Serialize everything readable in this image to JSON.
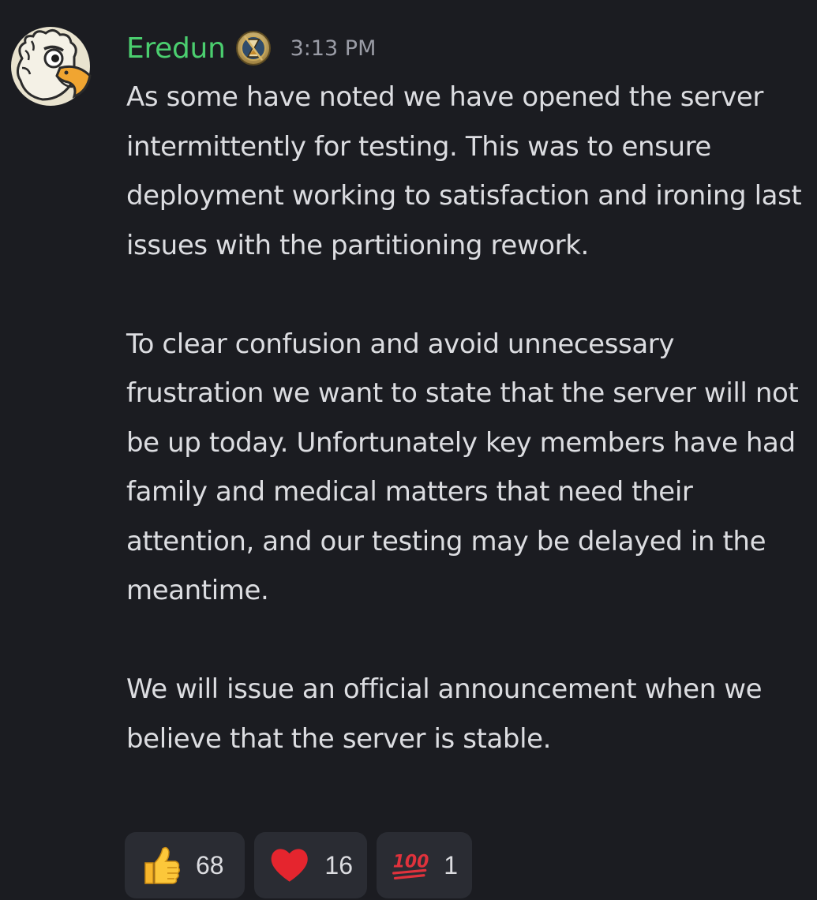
{
  "message": {
    "username": "Eredun",
    "role_icon": "hourglass-badge-icon",
    "timestamp": "3:13 PM",
    "avatar": "eagle-avatar",
    "paragraphs": [
      "As some have noted we have opened the server intermittently for testing. This was to ensure deployment working to satisfaction and ironing last issues with the partitioning rework.",
      "To clear confusion and avoid unnecessary frustration we want to state that the server will not be up today. Unfortunately key members have had family and medical matters that need their attention, and our testing may be delayed in the meantime.",
      "We will issue an official announcement when we believe that the server is stable."
    ]
  },
  "reactions": [
    {
      "emoji": "thumbs-up-icon",
      "count": "68"
    },
    {
      "emoji": "red-heart-icon",
      "count": "16"
    },
    {
      "emoji": "hundred-points-icon",
      "count": "1"
    }
  ],
  "colors": {
    "background": "#1b1c21",
    "username": "#4bce6f",
    "text": "#dcdde1",
    "timestamp": "#9a9ca6",
    "reaction_bg": "#2a2c33"
  }
}
